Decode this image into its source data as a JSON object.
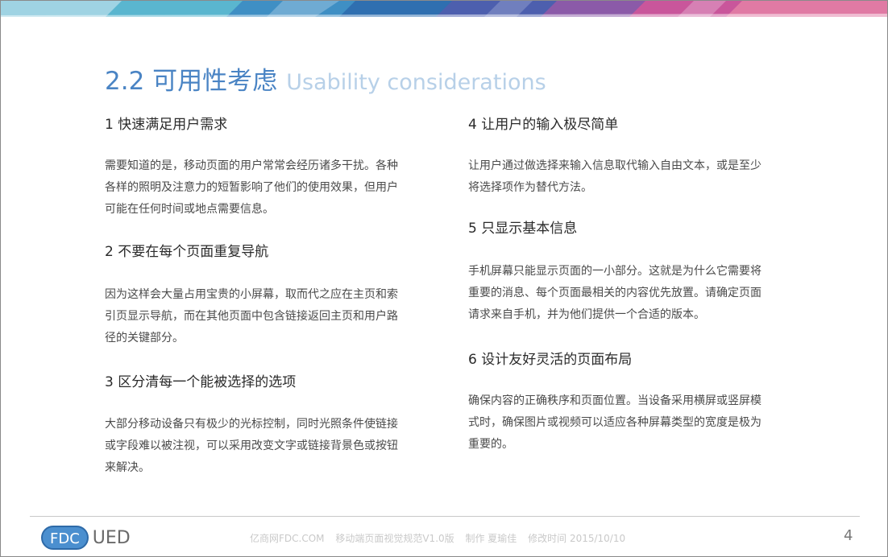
{
  "title": {
    "zh": "2.2 可用性考虑",
    "en": "Usability considerations"
  },
  "sections": [
    {
      "heading": "1 快速满足用户需求",
      "lines": [
        "需要知道的是，移动页面的用户常常会经历诸多干扰。各种",
        "各样的照明及注意力的短暂影响了他们的使用效果，但用户",
        "可能在任何时间或地点需要信息。"
      ]
    },
    {
      "heading": "2 不要在每个页面重复导航",
      "lines": [
        "因为这样会大量占用宝贵的小屏幕，取而代之应在主页和索",
        "引页显示导航，而在其他页面中包含链接返回主页和用户路",
        "径的关键部分。"
      ]
    },
    {
      "heading": "3 区分清每一个能被选择的选项",
      "lines": [
        "大部分移动设备只有极少的光标控制，同时光照条件使链接",
        "或字段难以被注视，可以采用改变文字或链接背景色或按钮",
        "来解决。"
      ]
    },
    {
      "heading": "4 让用户的输入极尽简单",
      "lines": [
        "让用户通过做选择来输入信息取代输入自由文本，或是至少",
        "将选择项作为替代方法。"
      ]
    },
    {
      "heading": "5 只显示基本信息",
      "lines": [
        "手机屏幕只能显示页面的一小部分。这就是为什么它需要将",
        "重要的消息、每个页面最相关的内容优先放置。请确定页面",
        "请求来自手机，并为他们提供一个合适的版本。"
      ]
    },
    {
      "heading": "6 设计友好灵活的页面布局",
      "lines": [
        "确保内容的正确秩序和页面位置。当设备采用横屏或竖屏模",
        "式时，确保图片或视频可以适应各种屏幕类型的宽度是极为",
        "重要的。"
      ]
    }
  ],
  "footer": {
    "logo_left": "FDC",
    "logo_right": "UED",
    "site": "亿商网FDC.COM",
    "doc_name": "移动端页面视觉规范V1.0版",
    "author": "制作 夏瑜佳",
    "modified": "修改时间  2015/10/10",
    "page_number": "4"
  },
  "colors": {
    "title": "#4a84c4",
    "title_en": "#b7d0e8",
    "logo_blue": "#4b8fcf"
  }
}
